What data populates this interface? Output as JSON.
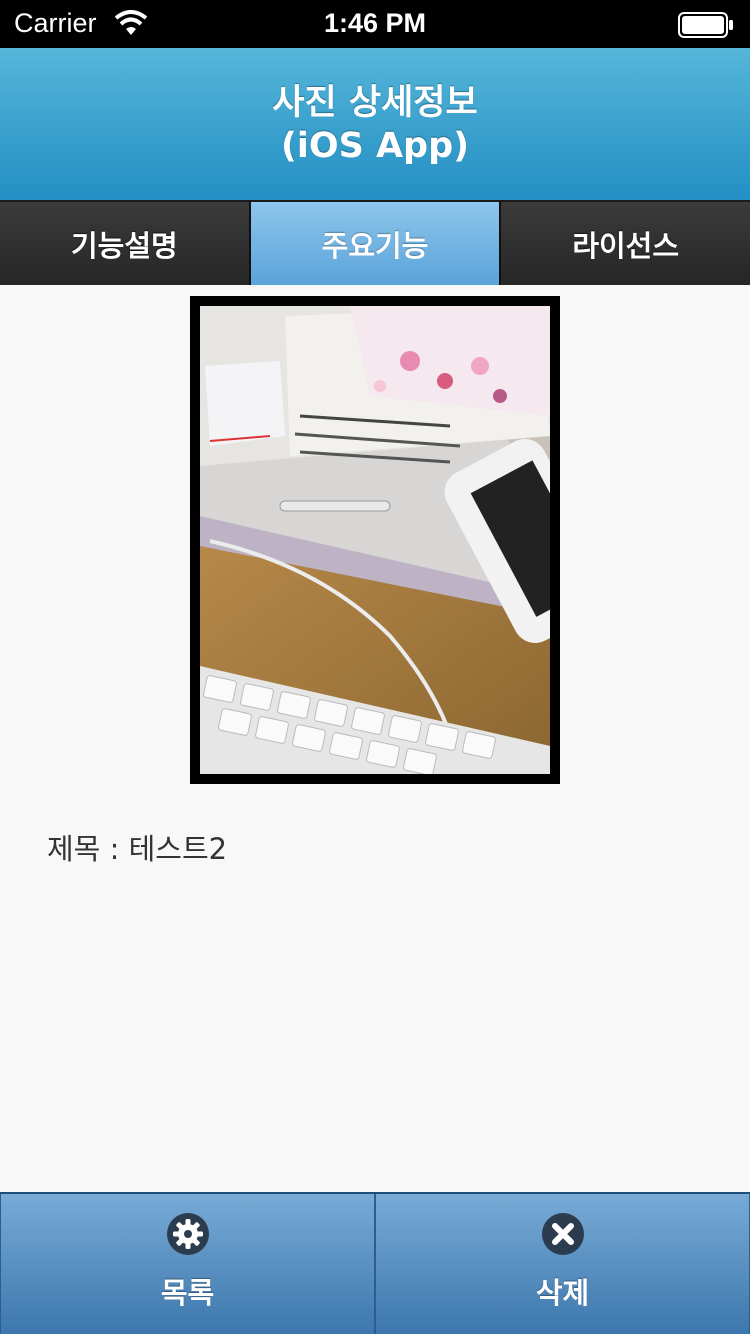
{
  "status_bar": {
    "carrier": "Carrier",
    "time": "1:46 PM"
  },
  "header": {
    "title_line1": "사진 상세정보",
    "title_line2": "(iOS App)"
  },
  "tabs": [
    {
      "label": "기능설명",
      "active": false
    },
    {
      "label": "주요기능",
      "active": true
    },
    {
      "label": "라이선스",
      "active": false
    }
  ],
  "photo": {
    "label": "photo"
  },
  "detail": {
    "title_label": "제목 : ",
    "title_value": "테스트2"
  },
  "bottom_bar": {
    "left": {
      "label": "목록",
      "icon": "gear-icon"
    },
    "right": {
      "label": "삭제",
      "icon": "close-icon"
    }
  },
  "colors": {
    "header_top": "#55b6d9",
    "header_bottom": "#238fc4",
    "tab_active": "#5aa3d9",
    "tab_inactive": "#2f2f2f",
    "bottom_bar": "#4e88bf"
  }
}
